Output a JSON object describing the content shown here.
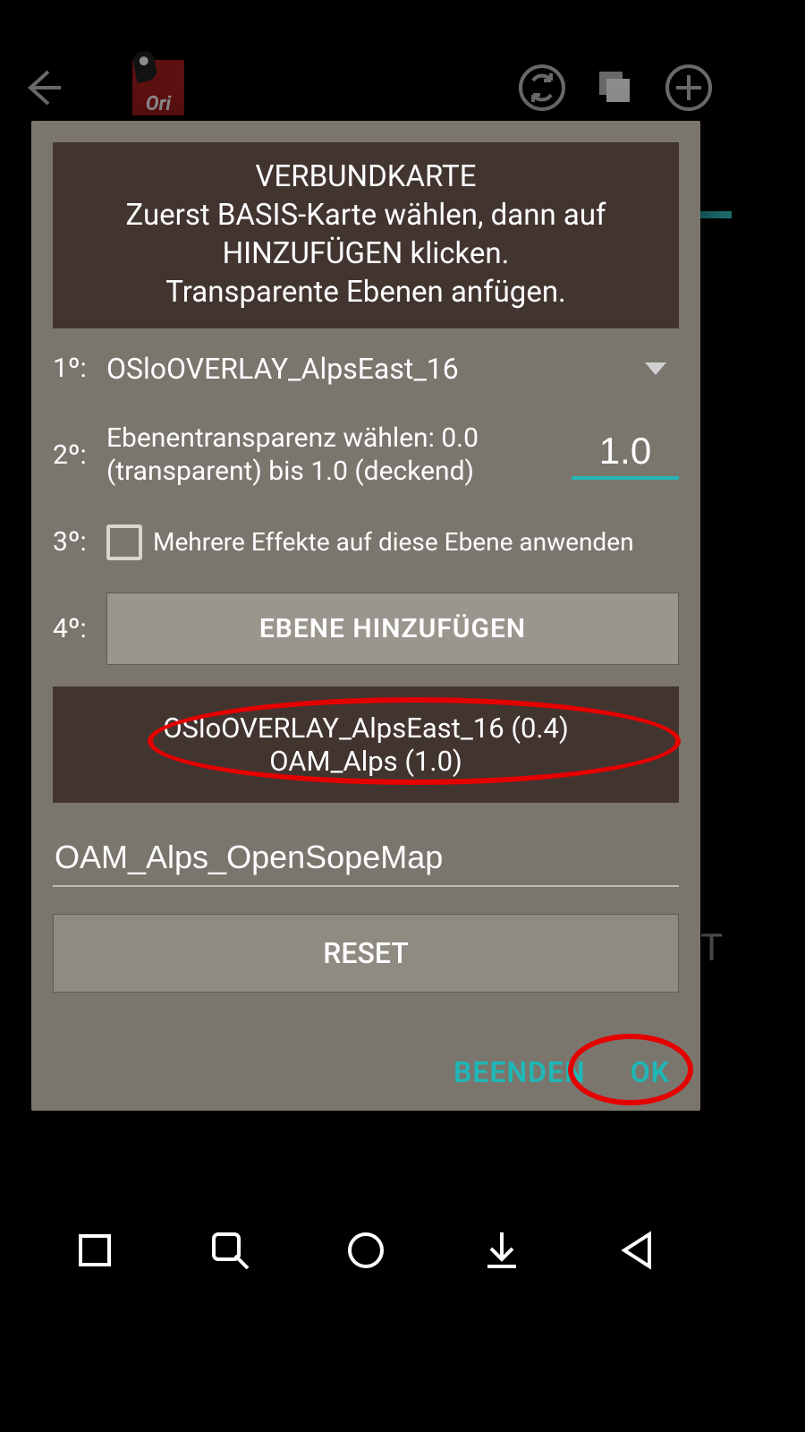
{
  "header": {
    "title_line1": "VERBUNDKARTE",
    "title_line2": "Zuerst BASIS-Karte wählen, dann auf HINZUFÜGEN klicken.",
    "title_line3": "Transparente Ebenen anfügen."
  },
  "steps": {
    "s1": {
      "ord": "1º:",
      "dropdown_value": "OSloOVERLAY_AlpsEast_16"
    },
    "s2": {
      "ord": "2º:",
      "label": "Ebenentransparenz wählen: 0.0 (transparent) bis 1.0 (deckend)",
      "value": "1.0"
    },
    "s3": {
      "ord": "3º:",
      "label": "Mehrere Effekte auf diese Ebene anwenden"
    },
    "s4": {
      "ord": "4º:",
      "button_label": "EBENE HINZUFÜGEN"
    }
  },
  "layers": {
    "line1": "OSloOVERLAY_AlpsEast_16 (0.4)",
    "line2": "OAM_Alps (1.0)"
  },
  "composite_name": "OAM_Alps_OpenSopeMap",
  "reset_label": "RESET",
  "actions": {
    "cancel": "BEENDEN",
    "ok": "OK"
  },
  "bg_letter": "T",
  "logo_text": "Ori"
}
